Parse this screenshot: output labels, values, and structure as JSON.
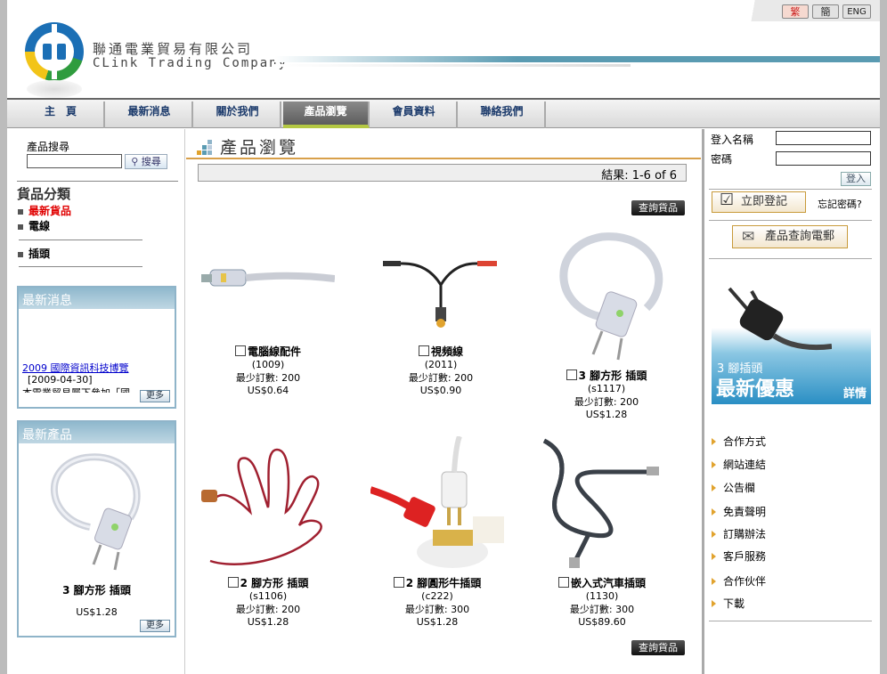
{
  "header": {
    "company_zh": "聯通電業貿易有限公司",
    "company_en": "CLink Trading Company",
    "lang": {
      "trad": "繁",
      "simp": "簡",
      "eng": "ENG"
    }
  },
  "nav": {
    "items": [
      "主　頁",
      "最新消息",
      "關於我們",
      "產品瀏覽",
      "會員資料",
      "聯絡我們"
    ],
    "active": "產品瀏覽"
  },
  "sidebar": {
    "search_label": "產品搜尋",
    "search_value": "",
    "search_button": "搜尋",
    "category_title": "貨品分類",
    "categories": [
      "最新貨品",
      "電線",
      "插頭"
    ],
    "news_box": {
      "title": "最新消息",
      "item_title": "2009 國際資訊科技博覽",
      "item_date": "[2009-04-30]",
      "item_excerpt": "本電業貿易屬下參加「國",
      "more": "更多"
    },
    "newprod_box": {
      "title": "最新產品",
      "name": "3 腳方形 插頭",
      "price": "US$1.28",
      "more": "更多"
    }
  },
  "main": {
    "title": "產品瀏覽",
    "result": "結果: 1-6 of 6",
    "query_button": "查詢貨品",
    "products": [
      {
        "name": "電腦線配件",
        "code": "(1009)",
        "min_order": "最少訂數: 200",
        "price": "US$0.64"
      },
      {
        "name": "視頻線",
        "code": "(2011)",
        "min_order": "最少訂數: 200",
        "price": "US$0.90"
      },
      {
        "name": "3 腳方形 插頭",
        "code": "(s1117)",
        "min_order": "最少訂數: 200",
        "price": "US$1.28"
      },
      {
        "name": "2 腳方形 插頭",
        "code": "(s1106)",
        "min_order": "最少訂數: 200",
        "price": "US$1.28"
      },
      {
        "name": "2 腳圓形牛插頭",
        "code": "(c222)",
        "min_order": "最少訂數: 300",
        "price": "US$1.28"
      },
      {
        "name": "嵌入式汽車插頭",
        "code": "(1130)",
        "min_order": "最少訂數: 300",
        "price": "US$89.60"
      }
    ]
  },
  "right": {
    "login_name_label": "登入名稱",
    "password_label": "密碼",
    "login_button": "登入",
    "register_button": "立即登記",
    "forgot": "忘記密碼?",
    "email_button": "產品查詢電郵",
    "promo": {
      "line1": "3 腳插頭",
      "line2": "最新優惠",
      "detail": "詳情"
    },
    "links": [
      "合作方式",
      "網站連結",
      "公告欄",
      "免責聲明",
      "訂購辦法",
      "客戶服務",
      "合作伙伴",
      "下載"
    ]
  },
  "colors": {
    "nav_active_underline": "#b4c843",
    "accent_line": "#5a9bb2",
    "box_border": "#8fb4c9",
    "new_item_red": "#e00000"
  }
}
